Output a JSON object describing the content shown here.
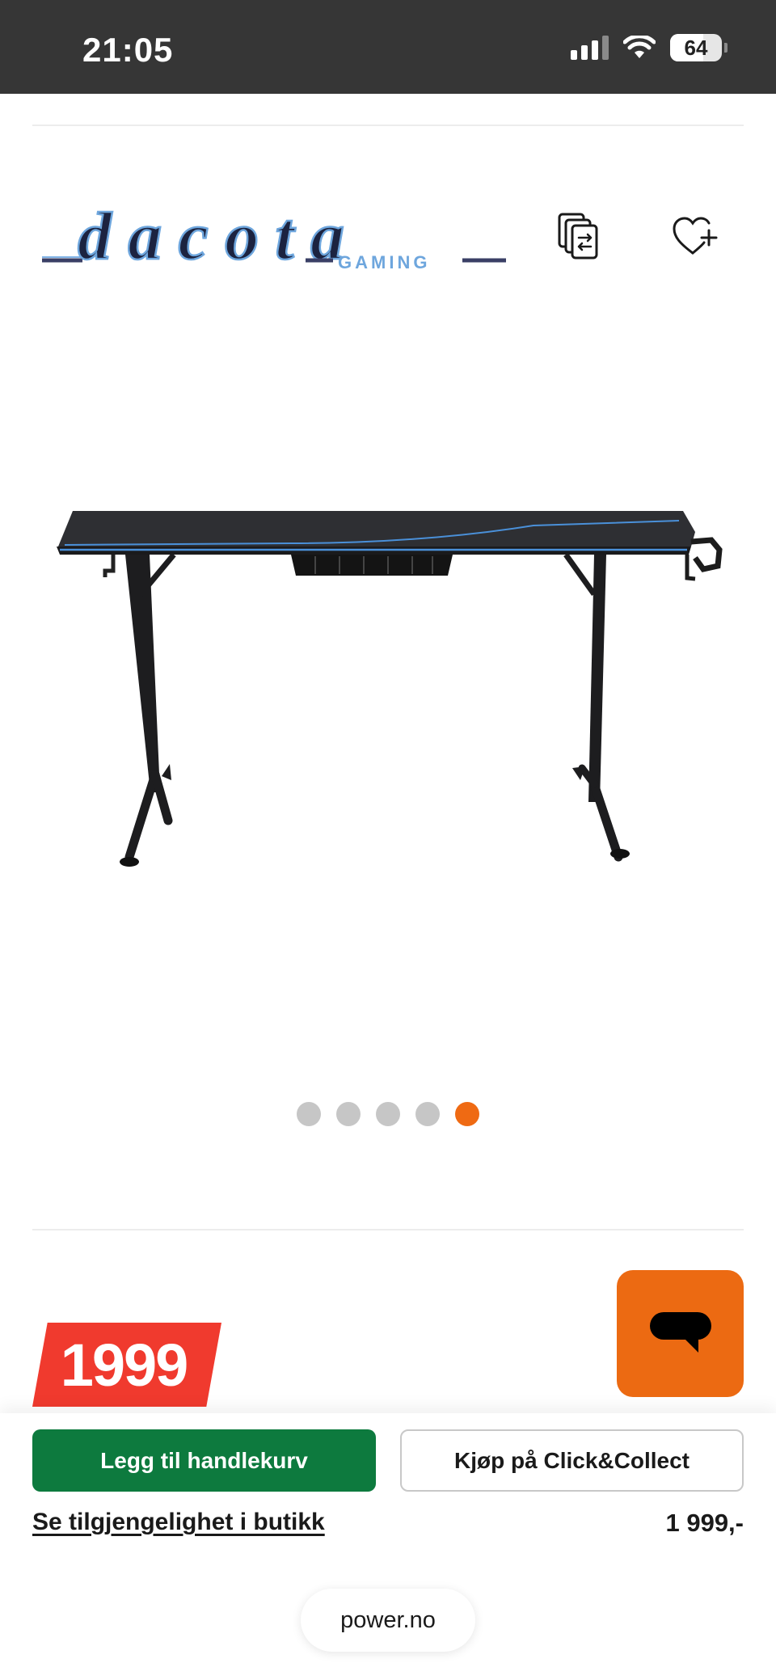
{
  "status_bar": {
    "time": "21:05",
    "battery": "64"
  },
  "brand": {
    "logo_text": "dacota",
    "logo_subtext": "GAMING"
  },
  "actions": {
    "compare_icon": "compare-icon",
    "wishlist_icon": "heart-plus-icon"
  },
  "gallery": {
    "image_count": 5,
    "active_index": 4
  },
  "price": {
    "amount": "1999"
  },
  "purchase": {
    "add_to_cart": "Legg til handlekurv",
    "click_collect": "Kjøp på Click&Collect",
    "availability": "Se tilgjengelighet i butikk",
    "price_display": "1 999,-"
  },
  "browser": {
    "url": "power.no"
  },
  "colors": {
    "accent": "#ef6a13",
    "cart_green": "#0d7a3e",
    "price_red": "#f03a2e"
  }
}
